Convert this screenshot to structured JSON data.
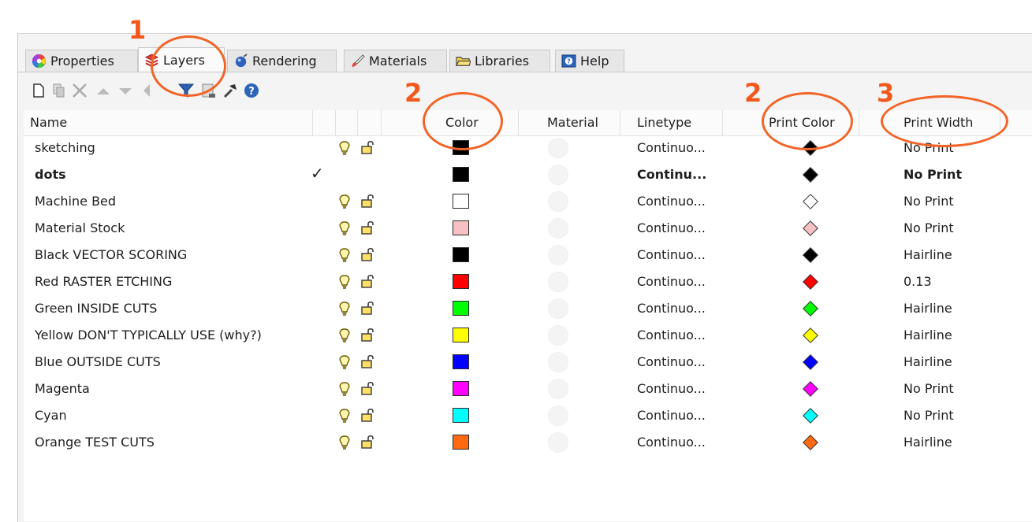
{
  "tabs": [
    {
      "label": "Properties",
      "icon": "color-wheel-icon",
      "active": false
    },
    {
      "label": "Layers",
      "icon": "layers-icon",
      "active": true
    },
    {
      "label": "Rendering",
      "icon": "teapot-icon",
      "active": false
    },
    {
      "label": "Materials",
      "icon": "paint-brush-icon",
      "active": false
    },
    {
      "label": "Libraries",
      "icon": "folder-icon",
      "active": false
    },
    {
      "label": "Help",
      "icon": "help-icon",
      "active": false
    }
  ],
  "toolbar": [
    "new-layer-icon",
    "new-sublayer-icon",
    "delete-icon",
    "move-up-icon",
    "move-down-icon",
    "move-left-icon",
    "filter-icon",
    "layer-page-icon",
    "tools-icon",
    "help-icon"
  ],
  "columns": {
    "name": "Name",
    "color": "Color",
    "material": "Material",
    "linetype": "Linetype",
    "print_color": "Print Color",
    "print_width": "Print Width"
  },
  "layers": [
    {
      "name": "sketching",
      "color": "#000000",
      "linetype": "Continuo...",
      "print_color": "#000000",
      "print_width": "No Print",
      "current": false
    },
    {
      "name": "dots",
      "color": "#000000",
      "linetype": "Continu...",
      "print_color": "#000000",
      "print_width": "No Print",
      "current": true
    },
    {
      "name": "Machine Bed",
      "color": "#ffffff",
      "linetype": "Continuo...",
      "print_color": "#ffffff",
      "print_width": "No Print",
      "current": false
    },
    {
      "name": "Material Stock",
      "color": "#f7c0c3",
      "linetype": "Continuo...",
      "print_color": "#f7c0c3",
      "print_width": "No Print",
      "current": false
    },
    {
      "name": "Black VECTOR SCORING",
      "color": "#000000",
      "linetype": "Continuo...",
      "print_color": "#000000",
      "print_width": "Hairline",
      "current": false
    },
    {
      "name": "Red RASTER ETCHING",
      "color": "#ff0000",
      "linetype": "Continuo...",
      "print_color": "#ff0000",
      "print_width": "0.13",
      "current": false
    },
    {
      "name": "Green INSIDE CUTS",
      "color": "#00ff00",
      "linetype": "Continuo...",
      "print_color": "#00ff00",
      "print_width": "Hairline",
      "current": false
    },
    {
      "name": "Yellow DON'T TYPICALLY USE (why?)",
      "color": "#ffff00",
      "linetype": "Continuo...",
      "print_color": "#ffff00",
      "print_width": "Hairline",
      "current": false
    },
    {
      "name": "Blue OUTSIDE CUTS",
      "color": "#0000ff",
      "linetype": "Continuo...",
      "print_color": "#0000ff",
      "print_width": "Hairline",
      "current": false
    },
    {
      "name": "Magenta",
      "color": "#ff00ff",
      "linetype": "Continuo...",
      "print_color": "#ff00ff",
      "print_width": "No Print",
      "current": false
    },
    {
      "name": "Cyan",
      "color": "#00ffff",
      "linetype": "Continuo...",
      "print_color": "#00ffff",
      "print_width": "No Print",
      "current": false
    },
    {
      "name": "Orange TEST CUTS",
      "color": "#ff6a10",
      "linetype": "Continuo...",
      "print_color": "#ff6a10",
      "print_width": "Hairline",
      "current": false
    }
  ],
  "annotations": {
    "layers_tab": "1",
    "color_column": "2",
    "print_color_column": "2",
    "print_width_column": "3",
    "accent": "#f26427"
  }
}
